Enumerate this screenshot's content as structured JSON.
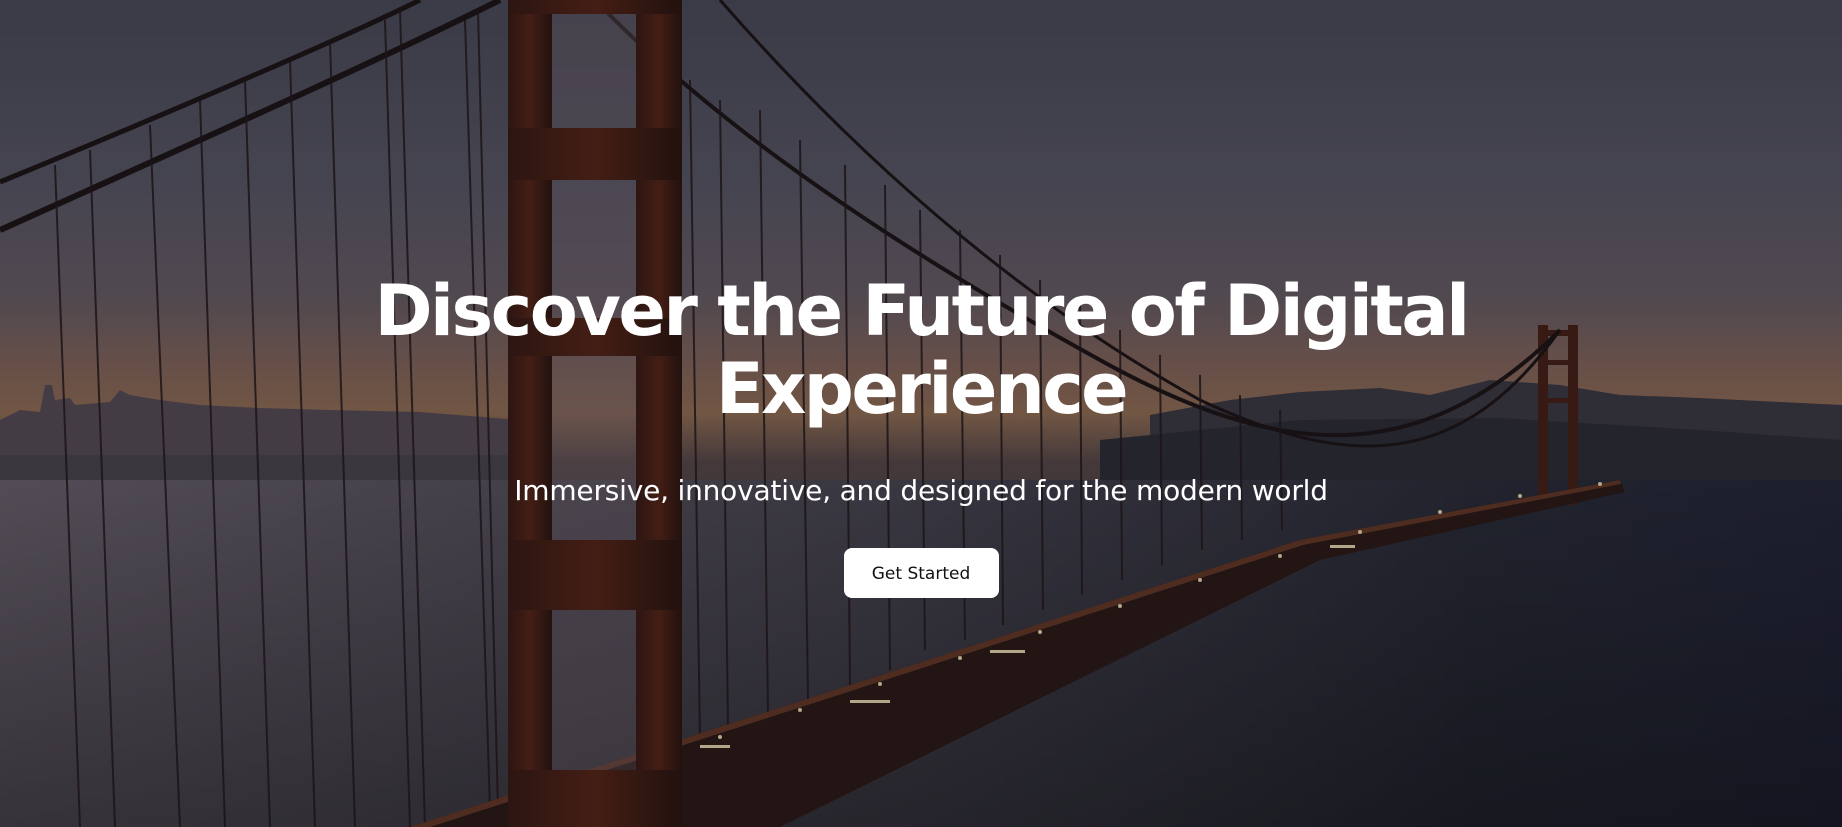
{
  "hero": {
    "title": "Discover the Future of Digital Experience",
    "subtitle": "Immersive, innovative, and designed for the modern world",
    "cta_label": "Get Started"
  },
  "colors": {
    "text": "#ffffff",
    "button_bg": "#ffffff",
    "button_text": "#111111",
    "bridge": "#5a2616",
    "water": "#2a2c38"
  }
}
